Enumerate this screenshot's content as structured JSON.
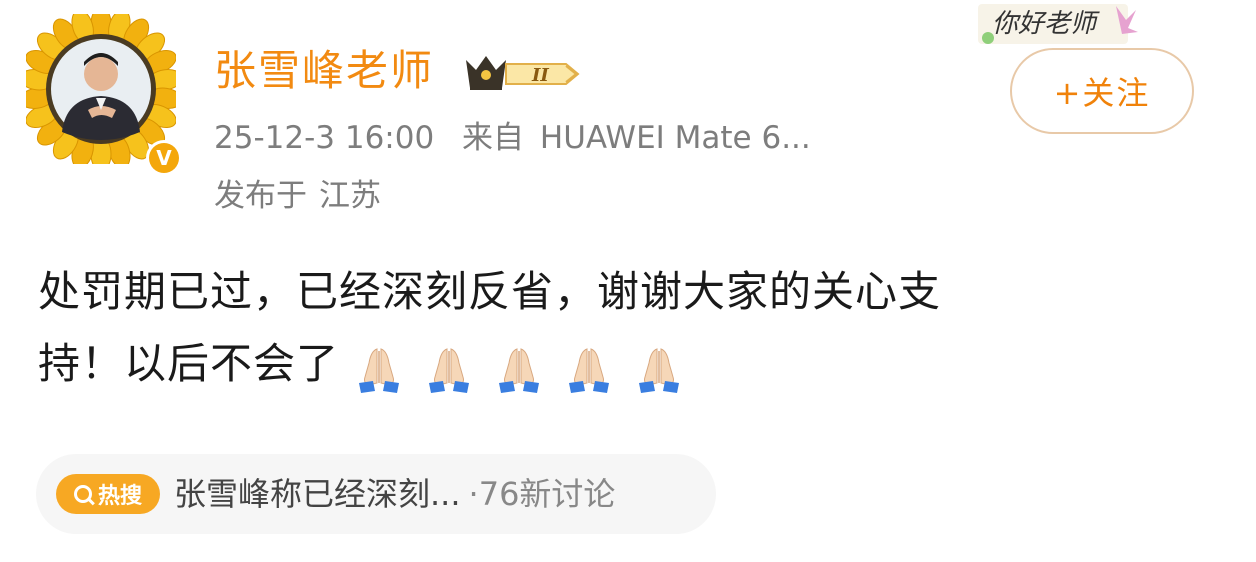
{
  "user": {
    "name": "张雪峰老师",
    "level_badge": "II",
    "verified_icon": "v-verified-icon",
    "crown_icon": "crown-icon"
  },
  "post": {
    "time": "25-12-3 16:00",
    "source_prefix": "来自",
    "source": "HUAWEI Mate 6...",
    "location_prefix": "发布于",
    "location": "江苏",
    "text_line1": "处罚期已过，已经深刻反省，谢谢大家的关心支",
    "text_line2": "持！以后不会了",
    "emoji_count": 5,
    "emoji_name": "pray-hands-icon"
  },
  "follow": {
    "label": "+关注"
  },
  "sticker": {
    "text": "你好老师"
  },
  "topic": {
    "tag_label": "热搜",
    "title": "张雪峰称已经深刻...",
    "separator": "·",
    "count": "76新讨论"
  },
  "colors": {
    "name": "#f28a11",
    "meta": "#7d7d7d",
    "accent": "#f0820a",
    "topic_tag": "#f7a823",
    "body_text": "#1a1a1a"
  }
}
